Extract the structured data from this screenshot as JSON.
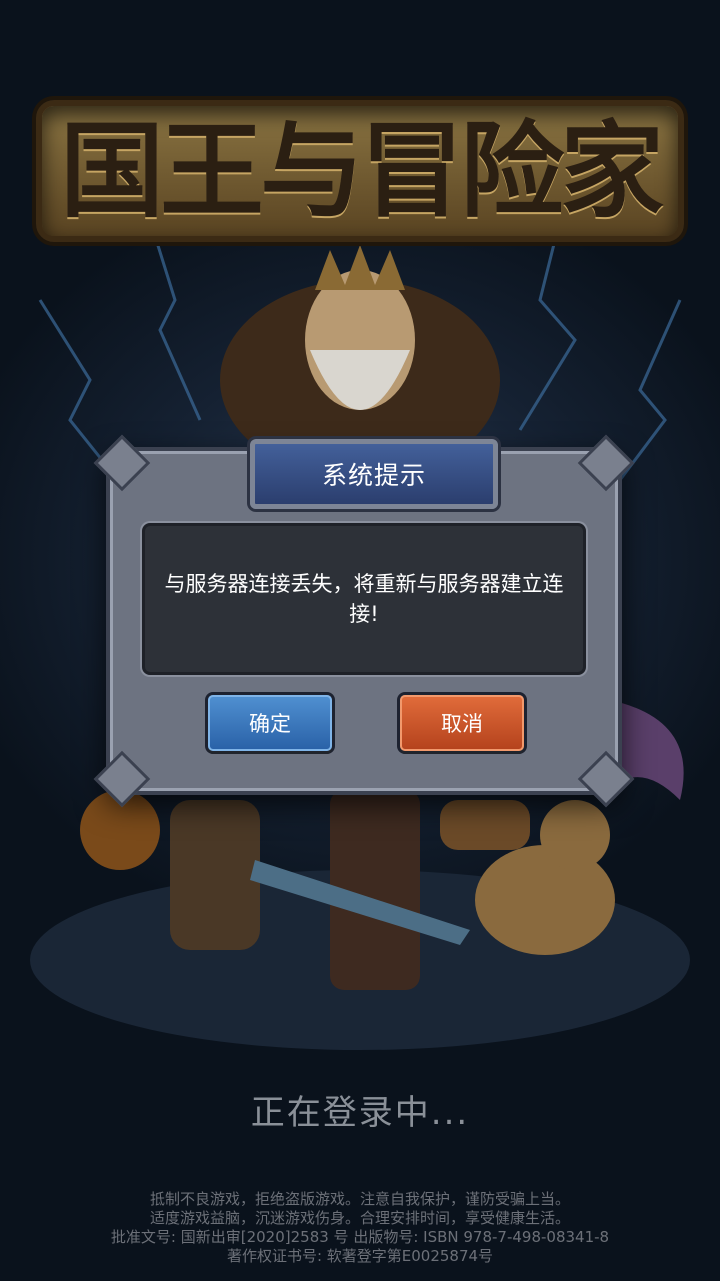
{
  "game": {
    "title_logo": "国王与冒险家"
  },
  "dialog": {
    "title": "系统提示",
    "message": "与服务器连接丢失，将重新与服务器建立连接!",
    "confirm_label": "确定",
    "cancel_label": "取消"
  },
  "status_text": "正在登录中...",
  "footer": {
    "line1": "抵制不良游戏，拒绝盗版游戏。注意自我保护，谨防受骗上当。",
    "line2": "适度游戏益脑，沉迷游戏伤身。合理安排时间，享受健康生活。",
    "line3": "批准文号: 国新出审[2020]2583 号    出版物号: ISBN 978-7-498-08341-8",
    "line4": "著作权证书号: 软著登字第E0025874号"
  },
  "colors": {
    "confirm_button": "#2a62a8",
    "cancel_button": "#b5431d",
    "dialog_header": "#2b3e6e"
  }
}
